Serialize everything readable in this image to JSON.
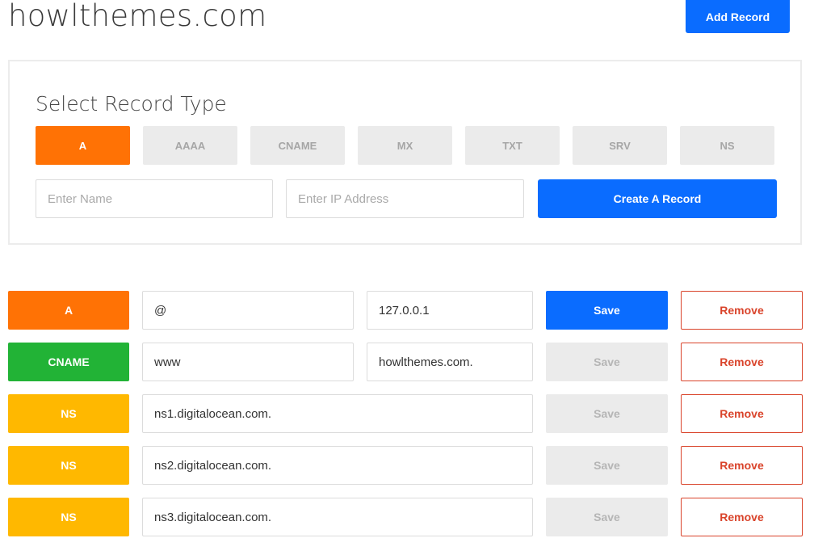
{
  "header": {
    "domain": "howlthemes.com",
    "add_record_label": "Add Record"
  },
  "record_form": {
    "title": "Select Record Type",
    "types": [
      "A",
      "AAAA",
      "CNAME",
      "MX",
      "TXT",
      "SRV",
      "NS"
    ],
    "selected_type": "A",
    "name_placeholder": "Enter Name",
    "ip_placeholder": "Enter IP Address",
    "create_label": "Create A Record"
  },
  "records": [
    {
      "type": "A",
      "type_color": "#ff7205",
      "name": "@",
      "value": "127.0.0.1",
      "save_label": "Save",
      "save_enabled": true,
      "remove_label": "Remove"
    },
    {
      "type": "CNAME",
      "type_color": "#22b336",
      "name": "www",
      "value": "howlthemes.com.",
      "save_label": "Save",
      "save_enabled": false,
      "remove_label": "Remove"
    },
    {
      "type": "NS",
      "type_color": "#ffb800",
      "name": "ns1.digitalocean.com.",
      "save_label": "Save",
      "save_enabled": false,
      "remove_label": "Remove"
    },
    {
      "type": "NS",
      "type_color": "#ffb800",
      "name": "ns2.digitalocean.com.",
      "save_label": "Save",
      "save_enabled": false,
      "remove_label": "Remove"
    },
    {
      "type": "NS",
      "type_color": "#ffb800",
      "name": "ns3.digitalocean.com.",
      "save_label": "Save",
      "save_enabled": false,
      "remove_label": "Remove"
    }
  ],
  "colors": {
    "primary": "#0a6cff",
    "active_type": "#ff7205",
    "danger": "#d9432a",
    "a_record": "#ff7205",
    "cname_record": "#22b336",
    "ns_record": "#ffb800"
  }
}
